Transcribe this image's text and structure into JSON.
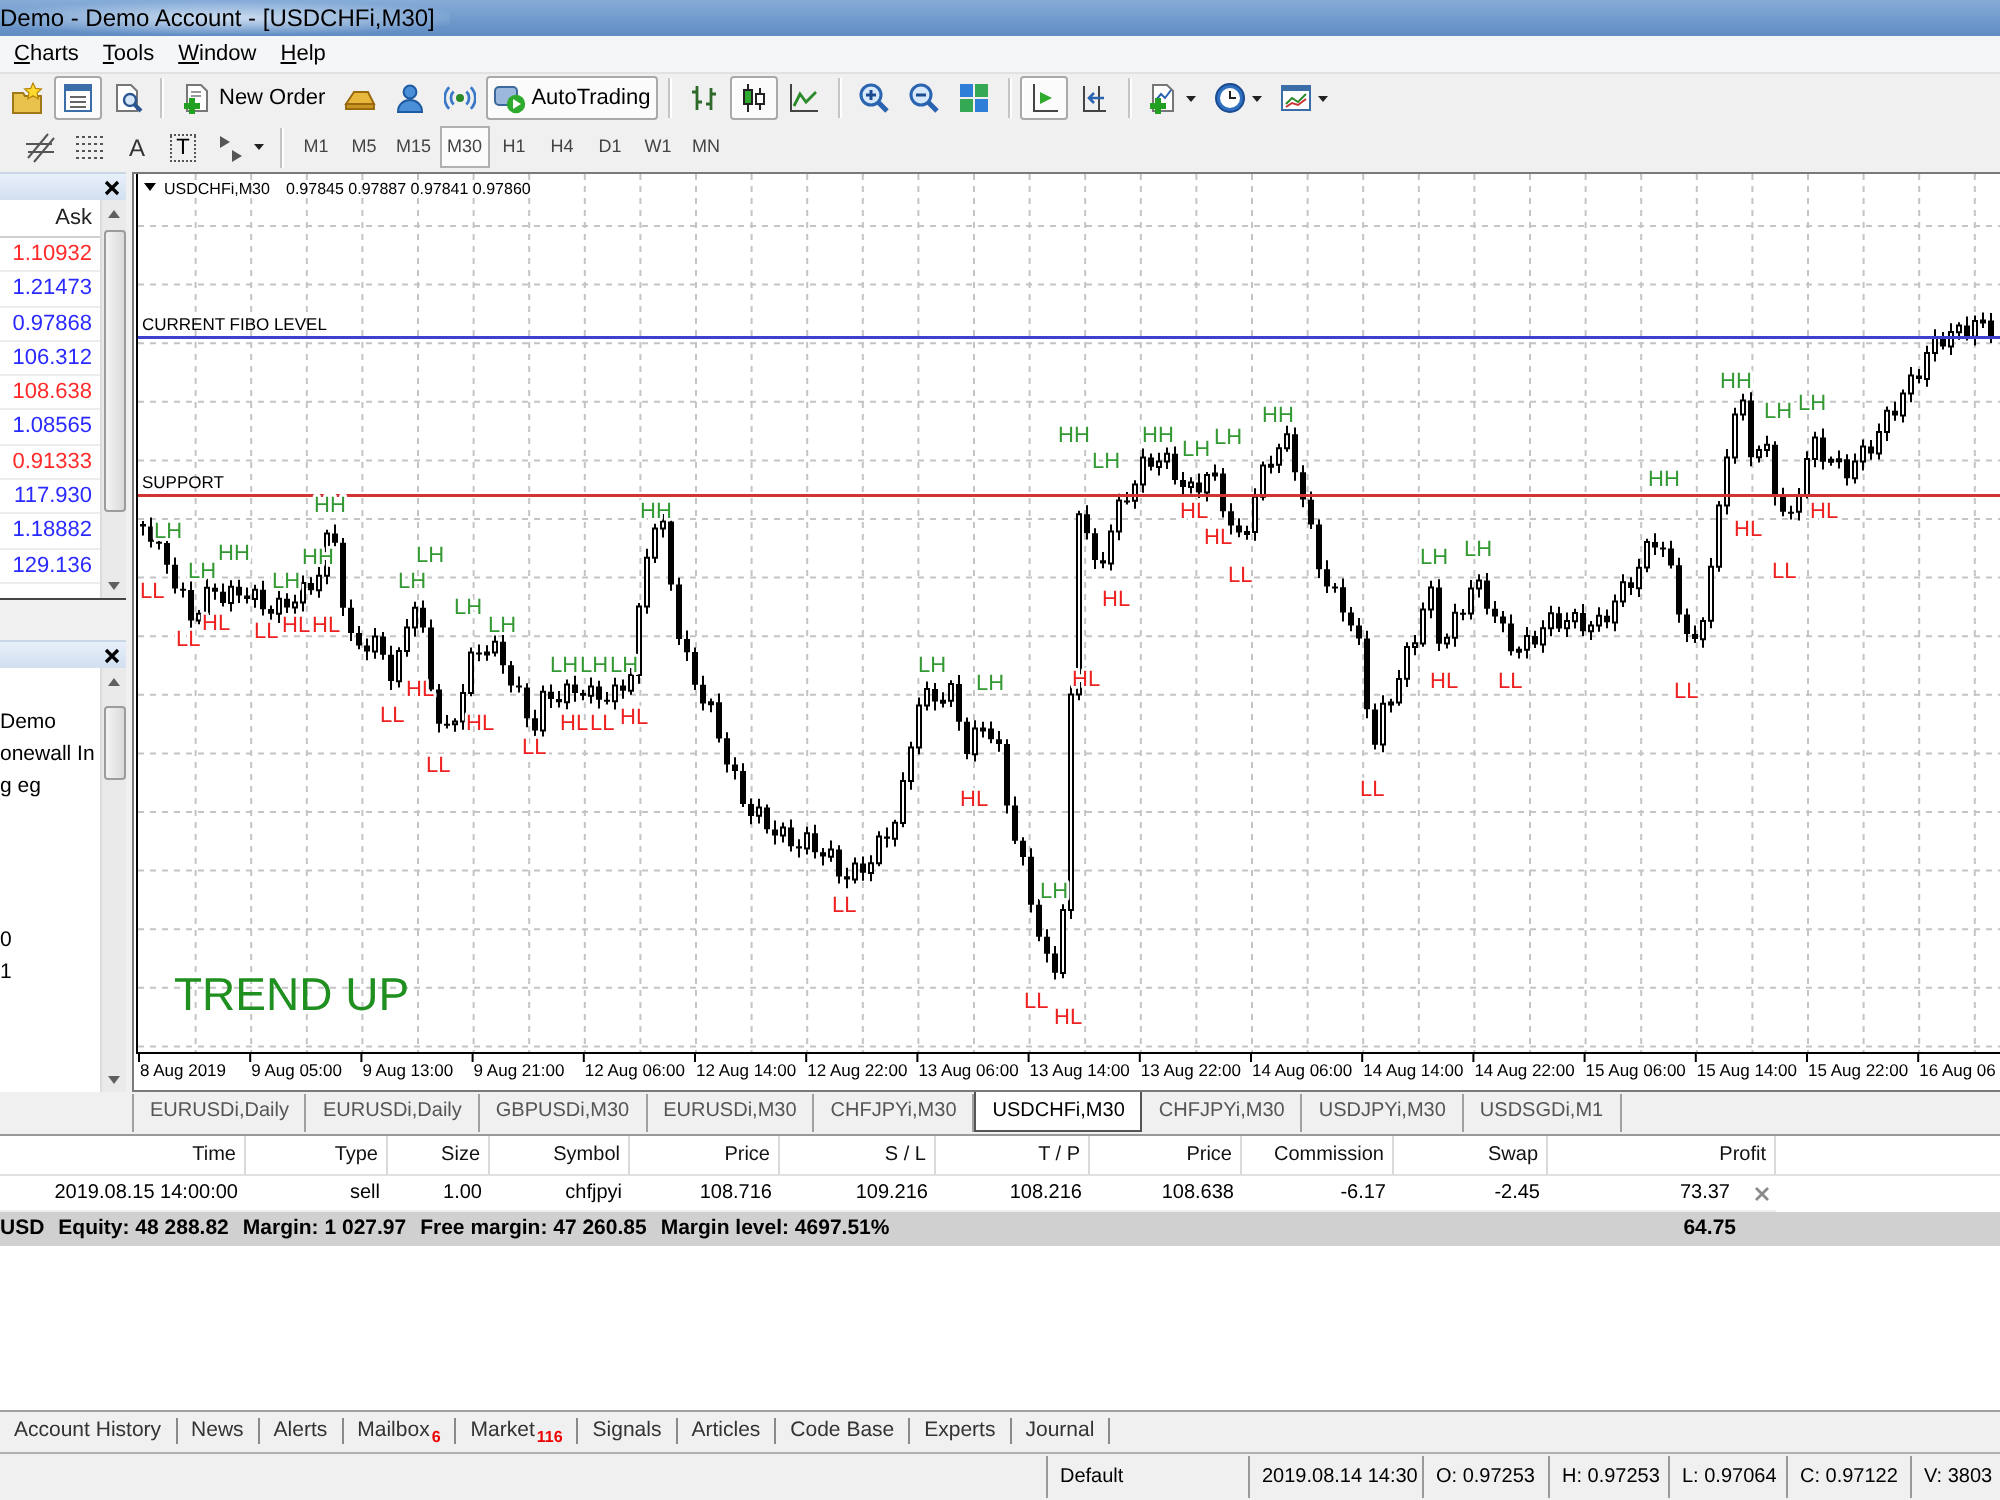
{
  "window": {
    "title": "Demo - Demo Account - [USDCHFi,M30]"
  },
  "menu": [
    {
      "label": "Charts"
    },
    {
      "label": "Tools"
    },
    {
      "label": "Window"
    },
    {
      "label": "Help"
    }
  ],
  "toolbar": [
    [
      {
        "kind": "profiles",
        "on": false
      },
      {
        "kind": "market-watch",
        "on": true
      },
      {
        "kind": "navigator",
        "on": false
      }
    ],
    [
      {
        "kind": "new-order",
        "label": "New Order",
        "on": false
      },
      {
        "kind": "gold",
        "on": false
      },
      {
        "kind": "person",
        "on": false
      },
      {
        "kind": "signal",
        "on": false
      },
      {
        "kind": "autotrading",
        "label": "AutoTrading",
        "on": true
      }
    ],
    [
      {
        "kind": "bar",
        "on": false
      },
      {
        "kind": "candle",
        "on": true
      },
      {
        "kind": "line",
        "on": false
      }
    ],
    [
      {
        "kind": "zoom-in",
        "on": false
      },
      {
        "kind": "zoom-out",
        "on": false
      },
      {
        "kind": "tile",
        "on": false
      }
    ],
    [
      {
        "kind": "auto-scroll",
        "on": true
      },
      {
        "kind": "shift",
        "on": false
      }
    ],
    [
      {
        "kind": "indicators",
        "on": false
      },
      {
        "kind": "periods",
        "on": false
      },
      {
        "kind": "templates",
        "on": false
      }
    ]
  ],
  "drawing_tools": [
    {
      "kind": "hatched"
    },
    {
      "kind": "dotted"
    },
    {
      "kind": "text",
      "glyph": "A"
    },
    {
      "kind": "label",
      "glyph": "T"
    },
    {
      "kind": "arrows"
    }
  ],
  "timeframes": [
    {
      "label": "M1",
      "selected": false
    },
    {
      "label": "M5",
      "selected": false
    },
    {
      "label": "M15",
      "selected": false
    },
    {
      "label": "M30",
      "selected": true
    },
    {
      "label": "H1",
      "selected": false
    },
    {
      "label": "H4",
      "selected": false
    },
    {
      "label": "D1",
      "selected": false
    },
    {
      "label": "W1",
      "selected": false
    },
    {
      "label": "MN",
      "selected": false
    }
  ],
  "market_watch": {
    "column": "Ask",
    "rows": [
      {
        "ask": "1.10932",
        "color": "#ff2a2a"
      },
      {
        "ask": "1.21473",
        "color": "#2a2aff"
      },
      {
        "ask": "0.97868",
        "color": "#2a2aff"
      },
      {
        "ask": "106.312",
        "color": "#2a2aff"
      },
      {
        "ask": "108.638",
        "color": "#ff2a2a"
      },
      {
        "ask": "1.08565",
        "color": "#2a2aff"
      },
      {
        "ask": "0.91333",
        "color": "#ff2a2a"
      },
      {
        "ask": "117.930",
        "color": "#2a2aff"
      },
      {
        "ask": "1.18882",
        "color": "#2a2aff"
      },
      {
        "ask": "129.136",
        "color": "#2a2aff"
      }
    ]
  },
  "navigator": {
    "groups": [
      [
        "Demo",
        "onewall In",
        "g eg"
      ],
      [
        "0",
        "1"
      ]
    ]
  },
  "chart": {
    "symbol": "USDCHFi,M30",
    "quote": "0.97845 0.97887 0.97841 0.97860",
    "levels": [
      {
        "label": "CURRENT FIBO LEVEL",
        "color": "#4040d0"
      },
      {
        "label": "SUPPORT",
        "color": "#d03434"
      }
    ],
    "swings": [
      {
        "text": "LH",
        "color": "#339933"
      },
      {
        "text": "LL",
        "color": "#ee2020"
      },
      {
        "text": "LH",
        "color": "#339933"
      },
      {
        "text": "HH",
        "color": "#339933"
      },
      {
        "text": "HL",
        "color": "#ee2020"
      },
      {
        "text": "LL",
        "color": "#ee2020"
      },
      {
        "text": "LH",
        "color": "#339933"
      },
      {
        "text": "LL",
        "color": "#ee2020"
      },
      {
        "text": "HH",
        "color": "#339933"
      },
      {
        "text": "HH",
        "color": "#339933"
      },
      {
        "text": "HL",
        "color": "#ee2020"
      },
      {
        "text": "HL",
        "color": "#ee2020"
      },
      {
        "text": "LH",
        "color": "#339933"
      },
      {
        "text": "LH",
        "color": "#339933"
      },
      {
        "text": "HL",
        "color": "#ee2020"
      },
      {
        "text": "LL",
        "color": "#ee2020"
      },
      {
        "text": "LL",
        "color": "#ee2020"
      },
      {
        "text": "LH",
        "color": "#339933"
      },
      {
        "text": "LH",
        "color": "#339933"
      },
      {
        "text": "HL",
        "color": "#ee2020"
      },
      {
        "text": "LL",
        "color": "#ee2020"
      },
      {
        "text": "LH",
        "color": "#339933"
      },
      {
        "text": "LH",
        "color": "#339933"
      },
      {
        "text": "HL",
        "color": "#ee2020"
      },
      {
        "text": "LH",
        "color": "#339933"
      },
      {
        "text": "LL",
        "color": "#ee2020"
      },
      {
        "text": "HH",
        "color": "#339933"
      },
      {
        "text": "HL",
        "color": "#ee2020"
      },
      {
        "text": "LL",
        "color": "#ee2020"
      },
      {
        "text": "LH",
        "color": "#339933"
      },
      {
        "text": "LH",
        "color": "#339933"
      },
      {
        "text": "HL",
        "color": "#ee2020"
      },
      {
        "text": "HH",
        "color": "#339933"
      },
      {
        "text": "LH",
        "color": "#339933"
      },
      {
        "text": "LL",
        "color": "#ee2020"
      },
      {
        "text": "LH",
        "color": "#339933"
      },
      {
        "text": "HL",
        "color": "#ee2020"
      },
      {
        "text": "HL",
        "color": "#ee2020"
      },
      {
        "text": "HL",
        "color": "#ee2020"
      },
      {
        "text": "HH",
        "color": "#339933"
      },
      {
        "text": "LH",
        "color": "#339933"
      },
      {
        "text": "HL",
        "color": "#ee2020"
      },
      {
        "text": "LH",
        "color": "#339933"
      },
      {
        "text": "HL",
        "color": "#ee2020"
      },
      {
        "text": "LL",
        "color": "#ee2020"
      },
      {
        "text": "HH",
        "color": "#339933"
      },
      {
        "text": "LL",
        "color": "#ee2020"
      },
      {
        "text": "LH",
        "color": "#339933"
      },
      {
        "text": "HL",
        "color": "#ee2020"
      },
      {
        "text": "LH",
        "color": "#339933"
      },
      {
        "text": "LL",
        "color": "#ee2020"
      },
      {
        "text": "HH",
        "color": "#339933"
      },
      {
        "text": "LL",
        "color": "#ee2020"
      },
      {
        "text": "HH",
        "color": "#339933"
      },
      {
        "text": "HL",
        "color": "#ee2020"
      },
      {
        "text": "LH",
        "color": "#339933"
      },
      {
        "text": "LL",
        "color": "#ee2020"
      },
      {
        "text": "LH",
        "color": "#339933"
      },
      {
        "text": "HL",
        "color": "#ee2020"
      }
    ],
    "trend": "TREND UP",
    "time_axis": [
      "8 Aug 2019",
      "9 Aug 05:00",
      "9 Aug 13:00",
      "9 Aug 21:00",
      "12 Aug 06:00",
      "12 Aug 14:00",
      "12 Aug 22:00",
      "13 Aug 06:00",
      "13 Aug 14:00",
      "13 Aug 22:00",
      "14 Aug 06:00",
      "14 Aug 14:00",
      "14 Aug 22:00",
      "15 Aug 06:00",
      "15 Aug 14:00",
      "15 Aug 22:00",
      "16 Aug 06"
    ]
  },
  "chart_tabs": [
    {
      "label": "EURUSDi,Daily",
      "selected": false
    },
    {
      "label": "EURUSDi,Daily",
      "selected": false
    },
    {
      "label": "GBPUSDi,M30",
      "selected": false
    },
    {
      "label": "EURUSDi,M30",
      "selected": false
    },
    {
      "label": "CHFJPYi,M30",
      "selected": false
    },
    {
      "label": "USDCHFi,M30",
      "selected": true
    },
    {
      "label": "CHFJPYi,M30",
      "selected": false
    },
    {
      "label": "USDJPYi,M30",
      "selected": false
    },
    {
      "label": "USDSGDi,M1",
      "selected": false
    }
  ],
  "trades": {
    "columns": [
      "Time",
      "Type",
      "Size",
      "Symbol",
      "Price",
      "S / L",
      "T / P",
      "Price",
      "Commission",
      "Swap",
      "Profit"
    ],
    "rows": [
      [
        "2019.08.15 14:00:00",
        "sell",
        "1.00",
        "chfjpyi",
        "108.716",
        "109.216",
        "108.216",
        "108.638",
        "-6.17",
        "-2.45",
        "73.37"
      ]
    ],
    "summary": [
      "USD",
      "Equity: 48 288.82",
      "Margin: 1 027.97",
      "Free margin: 47 260.85",
      "Margin level: 4697.51%"
    ],
    "summary_profit": "64.75"
  },
  "terminal_tabs": [
    {
      "label": "Account History",
      "selected": false
    },
    {
      "label": "News",
      "selected": false
    },
    {
      "label": "Alerts",
      "selected": false
    },
    {
      "label": "Mailbox",
      "count": "6",
      "selected": false
    },
    {
      "label": "Market",
      "count": "116",
      "selected": false
    },
    {
      "label": "Signals",
      "selected": false
    },
    {
      "label": "Articles",
      "selected": false
    },
    {
      "label": "Code Base",
      "selected": false
    },
    {
      "label": "Experts",
      "selected": false
    },
    {
      "label": "Journal",
      "selected": false
    }
  ],
  "status_bar": [
    "Default",
    "2019.08.14 14:30",
    "O: 0.97253",
    "H: 0.97253",
    "L: 0.97064",
    "C: 0.97122",
    "V: 3803"
  ]
}
